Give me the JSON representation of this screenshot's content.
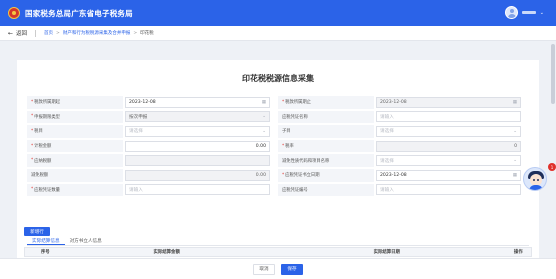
{
  "app": {
    "title": "国家税务总局广东省电子税务局"
  },
  "header": {
    "user_chevron": "⌄"
  },
  "nav": {
    "back_label": "返回",
    "breadcrumbs": [
      "首页",
      "财产和行为税税源采集及合并申报",
      "印花税"
    ]
  },
  "form": {
    "title": "印花税税源信息采集",
    "rows": [
      [
        {
          "label": "税款所属期起",
          "required": true,
          "value": "2023-12-08",
          "placeholder": "",
          "icon": "calendar-icon",
          "disabled": false
        },
        {
          "label": "税款所属期止",
          "required": true,
          "value": "2023-12-08",
          "placeholder": "",
          "icon": "calendar-icon",
          "disabled": true
        }
      ],
      [
        {
          "label": "申报期限类型",
          "required": true,
          "value": "按次申报",
          "placeholder": "",
          "icon": "chevron-down-icon",
          "disabled": true
        },
        {
          "label": "应税凭证名称",
          "required": false,
          "value": "",
          "placeholder": "请输入",
          "icon": "",
          "disabled": false
        }
      ],
      [
        {
          "label": "税目",
          "required": true,
          "value": "",
          "placeholder": "请选择",
          "icon": "chevron-down-icon",
          "disabled": false
        },
        {
          "label": "子目",
          "required": false,
          "value": "",
          "placeholder": "请选择",
          "icon": "chevron-down-icon",
          "disabled": false
        }
      ],
      [
        {
          "label": "计税金额",
          "required": true,
          "value": "0.00",
          "placeholder": "",
          "icon": "",
          "disabled": false
        },
        {
          "label": "税率",
          "required": true,
          "value": "0",
          "placeholder": "",
          "icon": "",
          "disabled": true
        }
      ],
      [
        {
          "label": "应纳税额",
          "required": true,
          "value": "",
          "placeholder": "",
          "icon": "",
          "disabled": true
        },
        {
          "label": "减免性质代码和项目名称",
          "required": false,
          "value": "",
          "placeholder": "请选择",
          "icon": "chevron-down-icon",
          "disabled": false
        }
      ],
      [
        {
          "label": "减免税额",
          "required": false,
          "value": "0.00",
          "placeholder": "",
          "icon": "",
          "disabled": true
        },
        {
          "label": "应税凭证书立日期",
          "required": true,
          "value": "2023-12-08",
          "placeholder": "",
          "icon": "calendar-icon",
          "disabled": false
        }
      ],
      [
        {
          "label": "应税凭证数量",
          "required": true,
          "value": "",
          "placeholder": "请输入",
          "icon": "",
          "disabled": false
        },
        {
          "label": "应税凭证编号",
          "required": false,
          "value": "",
          "placeholder": "请输入",
          "icon": "",
          "disabled": false
        }
      ]
    ]
  },
  "tabs": [
    {
      "label": "实际结算信息",
      "active": true
    },
    {
      "label": "对方书立人信息",
      "active": false
    }
  ],
  "add_row_label": "新增行",
  "table": {
    "columns": [
      "序号",
      "实际结算金额",
      "实际结算日期",
      "操作"
    ]
  },
  "footer": {
    "cancel_label": "取消",
    "save_label": "保存"
  },
  "float": {
    "badge": "1"
  },
  "colors": {
    "primary": "#2b63e8",
    "required": "#e0302a"
  }
}
